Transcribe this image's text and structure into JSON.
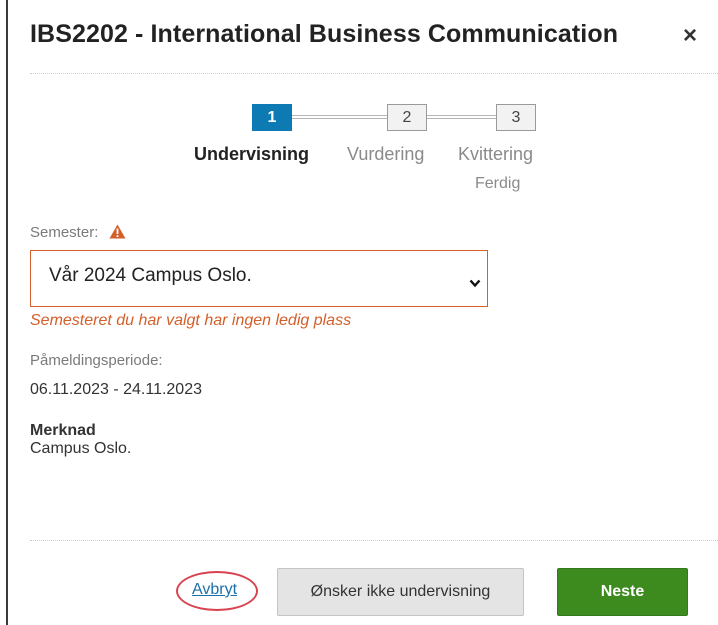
{
  "modal": {
    "title": "IBS2202 - International Business Communication",
    "close_symbol": "×"
  },
  "stepper": {
    "steps": [
      {
        "number": "1",
        "label": "Undervisning",
        "state": "active"
      },
      {
        "number": "2",
        "label": "Vurdering",
        "state": "inactive"
      },
      {
        "number": "3",
        "label": "Kvittering",
        "sublabel": "Ferdig",
        "state": "inactive"
      }
    ],
    "active_color": "#0e7ab3"
  },
  "form": {
    "semester_label": "Semester:",
    "semester_warning_icon": "warning-triangle-icon",
    "semester_selected": "Vår 2024 Campus Oslo.",
    "semester_error": "Semesteret du har valgt har ingen ledig plass",
    "error_color": "#d35f2a",
    "period_label": "Påmeldingsperiode:",
    "period_value": "06.11.2023 - 24.11.2023",
    "note_label": "Merknad",
    "note_value": "Campus Oslo."
  },
  "footer": {
    "cancel_label": "Avbryt",
    "decline_label": "Ønsker ikke undervisning",
    "next_label": "Neste",
    "next_color": "#3d8a1f"
  }
}
